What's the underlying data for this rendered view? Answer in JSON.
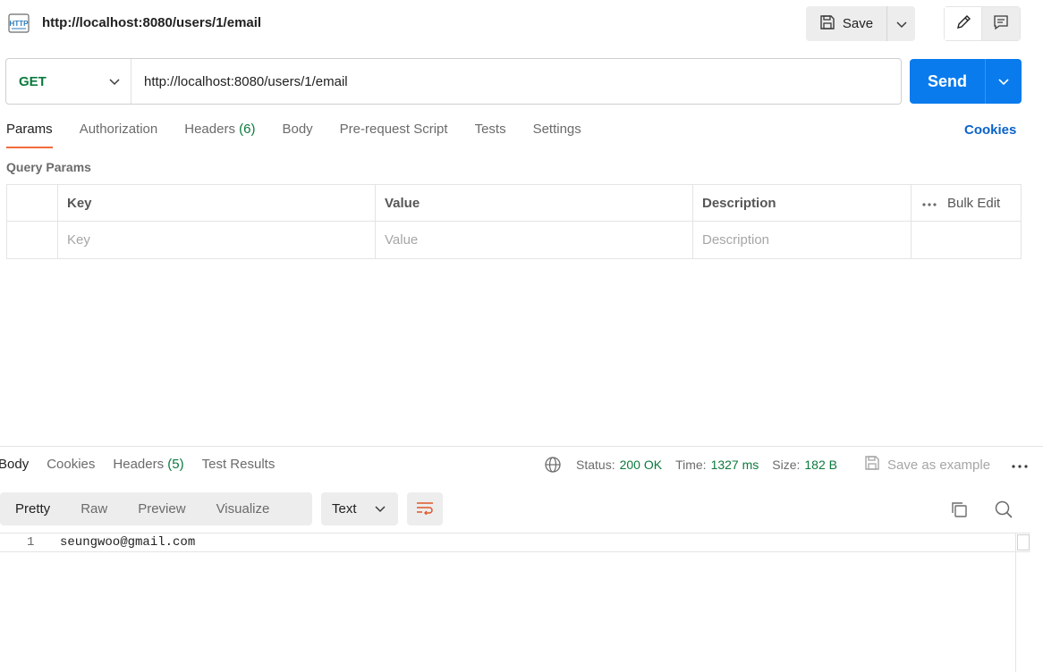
{
  "request": {
    "title": "http://localhost:8080/users/1/email",
    "method": "GET",
    "url": "http://localhost:8080/users/1/email"
  },
  "toolbar": {
    "save_label": "Save",
    "send_label": "Send"
  },
  "request_tabs": [
    {
      "label": "Params",
      "active": true
    },
    {
      "label": "Authorization"
    },
    {
      "label": "Headers",
      "count": "(6)"
    },
    {
      "label": "Body"
    },
    {
      "label": "Pre-request Script"
    },
    {
      "label": "Tests"
    },
    {
      "label": "Settings"
    }
  ],
  "cookies_link": "Cookies",
  "query_params": {
    "title": "Query Params",
    "columns": [
      "Key",
      "Value",
      "Description"
    ],
    "bulk_edit": "Bulk Edit",
    "placeholders": [
      "Key",
      "Value",
      "Description"
    ]
  },
  "response": {
    "tabs": [
      {
        "label": "Body",
        "active": true
      },
      {
        "label": "Cookies"
      },
      {
        "label": "Headers",
        "count": "(5)"
      },
      {
        "label": "Test Results"
      }
    ],
    "status_label": "Status:",
    "status_value": "200 OK",
    "time_label": "Time:",
    "time_value": "1327 ms",
    "size_label": "Size:",
    "size_value": "182 B",
    "save_example": "Save as example",
    "formats": [
      {
        "label": "Pretty",
        "active": true
      },
      {
        "label": "Raw"
      },
      {
        "label": "Preview"
      },
      {
        "label": "Visualize"
      }
    ],
    "content_type": "Text",
    "lines": [
      {
        "number": "1",
        "text": "seungwoo@gmail.com"
      }
    ]
  },
  "colors": {
    "accent_orange": "#f26b3a",
    "send_blue": "#097bed",
    "method_green": "#0b7a3e",
    "link_blue": "#0b63c9"
  }
}
